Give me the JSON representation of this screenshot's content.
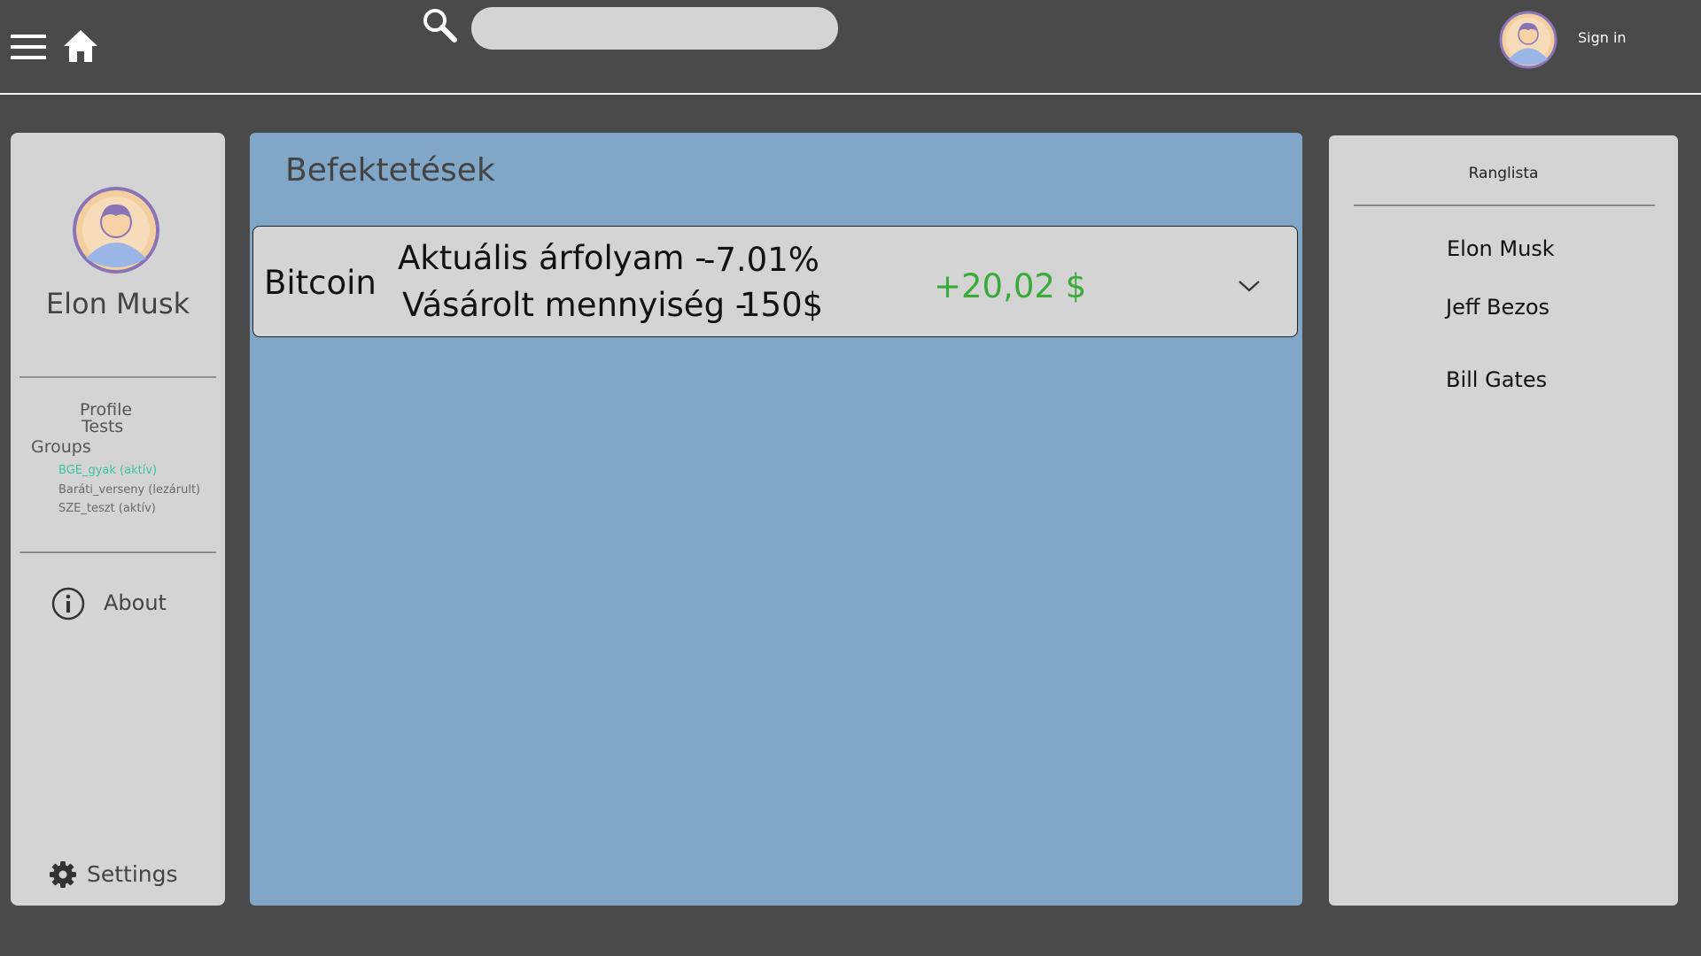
{
  "header": {
    "search_placeholder": "",
    "signin_label": "Sign in"
  },
  "sidebar": {
    "user_name": "Elon Musk",
    "nav": {
      "profile": "Profile",
      "tests": "Tests",
      "groups": "Groups"
    },
    "groups": [
      {
        "label": "BGE_gyak (aktív)",
        "color": "#3cc4a0"
      },
      {
        "label": "Baráti_verseny (lezárult)",
        "color": "#6a6a6a"
      },
      {
        "label": "SZE_teszt (aktív)",
        "color": "#6a6a6a"
      }
    ],
    "about_label": "About",
    "settings_label": "Settings"
  },
  "main": {
    "title": "Befektetések",
    "investments": [
      {
        "name": "Bitcoin",
        "rate_label": "Aktuális árfolyam -",
        "rate_value": "-7.01%",
        "amount_label": "Vásárolt mennyiség -",
        "amount_value": "150$",
        "profit": "+20,02 $",
        "profit_color": "#3aaa3a"
      }
    ]
  },
  "leaderboard": {
    "title": "Ranglista",
    "entries": [
      "Elon Musk",
      "Jeff Bezos",
      "Bill Gates"
    ]
  },
  "colors": {
    "background": "#4a4a4a",
    "panel": "#d4d4d4",
    "main_panel": "#80a6c8",
    "active_group": "#3cc4a0",
    "profit": "#3aaa3a"
  }
}
